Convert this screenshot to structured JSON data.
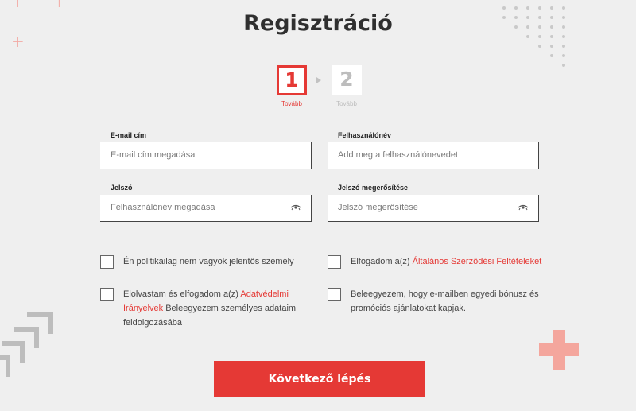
{
  "page": {
    "title": "Regisztráció"
  },
  "steps": [
    {
      "number": "1",
      "label": "Tovább",
      "active": true
    },
    {
      "number": "2",
      "label": "Tovább",
      "active": false
    }
  ],
  "form": {
    "email": {
      "label": "E-mail cím",
      "placeholder": "E-mail cím megadása"
    },
    "username": {
      "label": "Felhasználónév",
      "placeholder": "Add meg a felhasználónevedet"
    },
    "password": {
      "label": "Jelszó",
      "placeholder": "Felhasználónév megadása"
    },
    "password_confirm": {
      "label": "Jelszó megerősítése",
      "placeholder": "Jelszó megerősítése"
    }
  },
  "checkboxes": {
    "politically_exposed": {
      "text": "Én politikailag nem vagyok jelentős személy"
    },
    "terms": {
      "prefix": "Elfogadom a(z) ",
      "link": "Általános Szerződési Feltételeket"
    },
    "privacy": {
      "prefix": "Elolvastam és elfogadom a(z) ",
      "link": "Adatvédelmi Irányelvek",
      "suffix": " Beleegyezem személyes adataim feldolgozásába"
    },
    "marketing": {
      "text": "Beleegyezem, hogy e-mailben egyedi bónusz és promóciós ajánlatokat kapjak."
    }
  },
  "submit": {
    "label": "Következő lépés"
  },
  "colors": {
    "accent": "#e53935",
    "background": "#efefef",
    "decor_pink": "#f4a69d"
  }
}
